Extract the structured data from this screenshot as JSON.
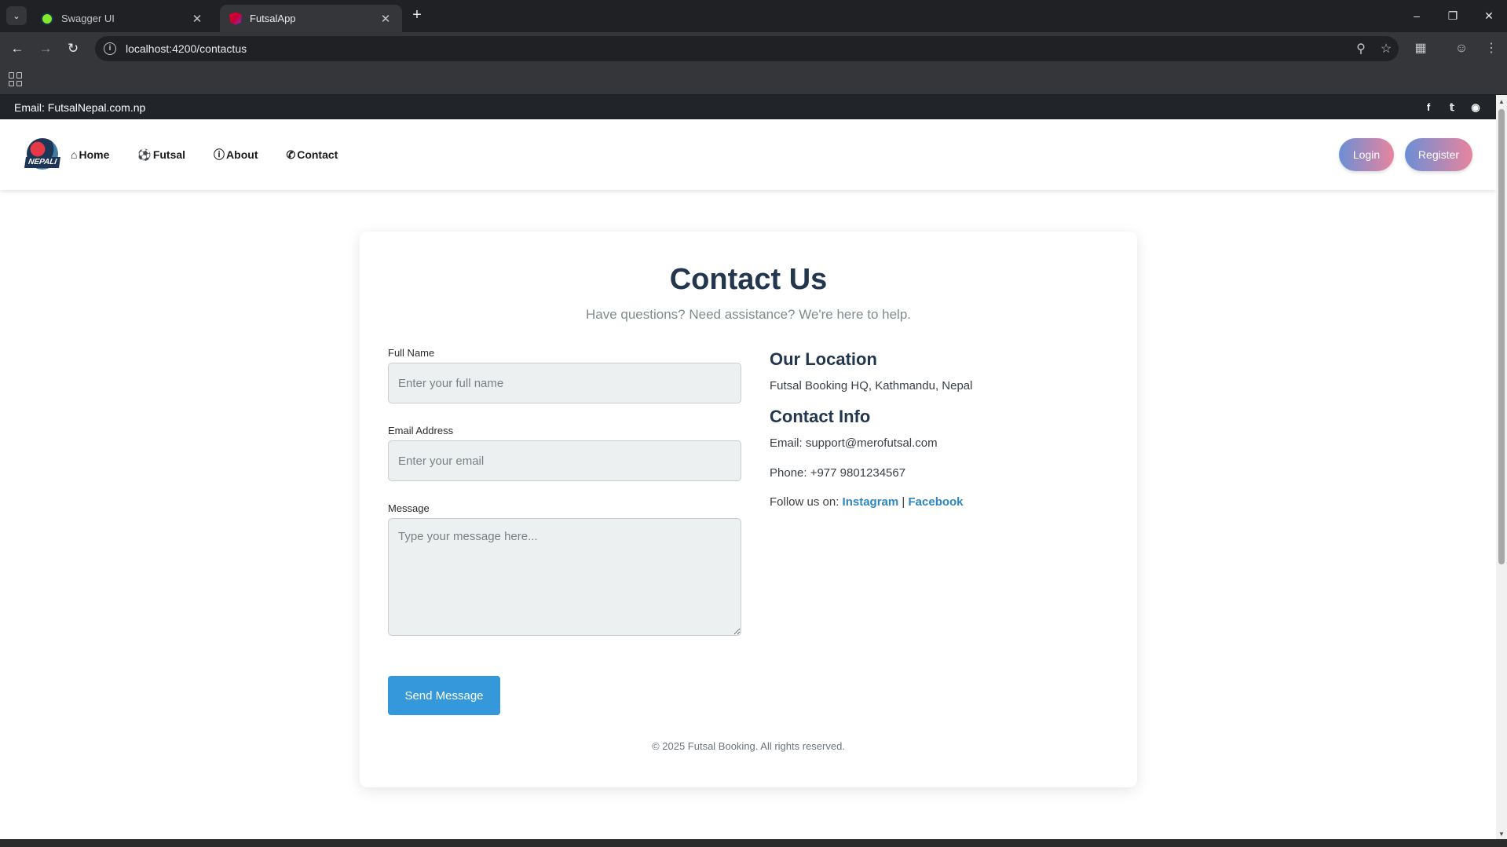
{
  "browser": {
    "tabs": [
      {
        "title": "Swagger UI",
        "active": false,
        "icon": "swagger-favicon"
      },
      {
        "title": "FutsalApp",
        "active": true,
        "icon": "angular-favicon"
      }
    ],
    "url": "localhost:4200/contactus"
  },
  "topbar": {
    "email": "Email: FutsalNepal.com.np",
    "social_icons": [
      "facebook-icon",
      "twitter-icon",
      "instagram-icon"
    ]
  },
  "navbar": {
    "logo_text": "NEPALI",
    "links": [
      {
        "label": "Home",
        "icon": "home-icon"
      },
      {
        "label": "Futsal",
        "icon": "football-icon"
      },
      {
        "label": "About",
        "icon": "info-icon"
      },
      {
        "label": "Contact",
        "icon": "phone-icon"
      }
    ],
    "login_label": "Login",
    "register_label": "Register",
    "accent_gradient": [
      "#6b8fd6",
      "#e8849e"
    ]
  },
  "contact": {
    "title": "Contact Us",
    "subtitle": "Have questions? Need assistance? We're here to help.",
    "form": {
      "name_label": "Full Name",
      "name_placeholder": "Enter your full name",
      "email_label": "Email Address",
      "email_placeholder": "Enter your email",
      "message_label": "Message",
      "message_placeholder": "Type your message here...",
      "submit_label": "Send Message"
    },
    "location_heading": "Our Location",
    "location_text": "Futsal Booking HQ, Kathmandu, Nepal",
    "info_heading": "Contact Info",
    "email_text": "Email: support@merofutsal.com",
    "phone_text": "Phone: +977 9801234567",
    "follow_prefix": "Follow us on:",
    "instagram_label": "Instagram",
    "separator": "|",
    "facebook_label": "Facebook",
    "footer": "© 2025 Futsal Booking. All rights reserved.",
    "colors": {
      "heading": "#22364d",
      "button": "#3498db",
      "link": "#2e86c1"
    }
  }
}
